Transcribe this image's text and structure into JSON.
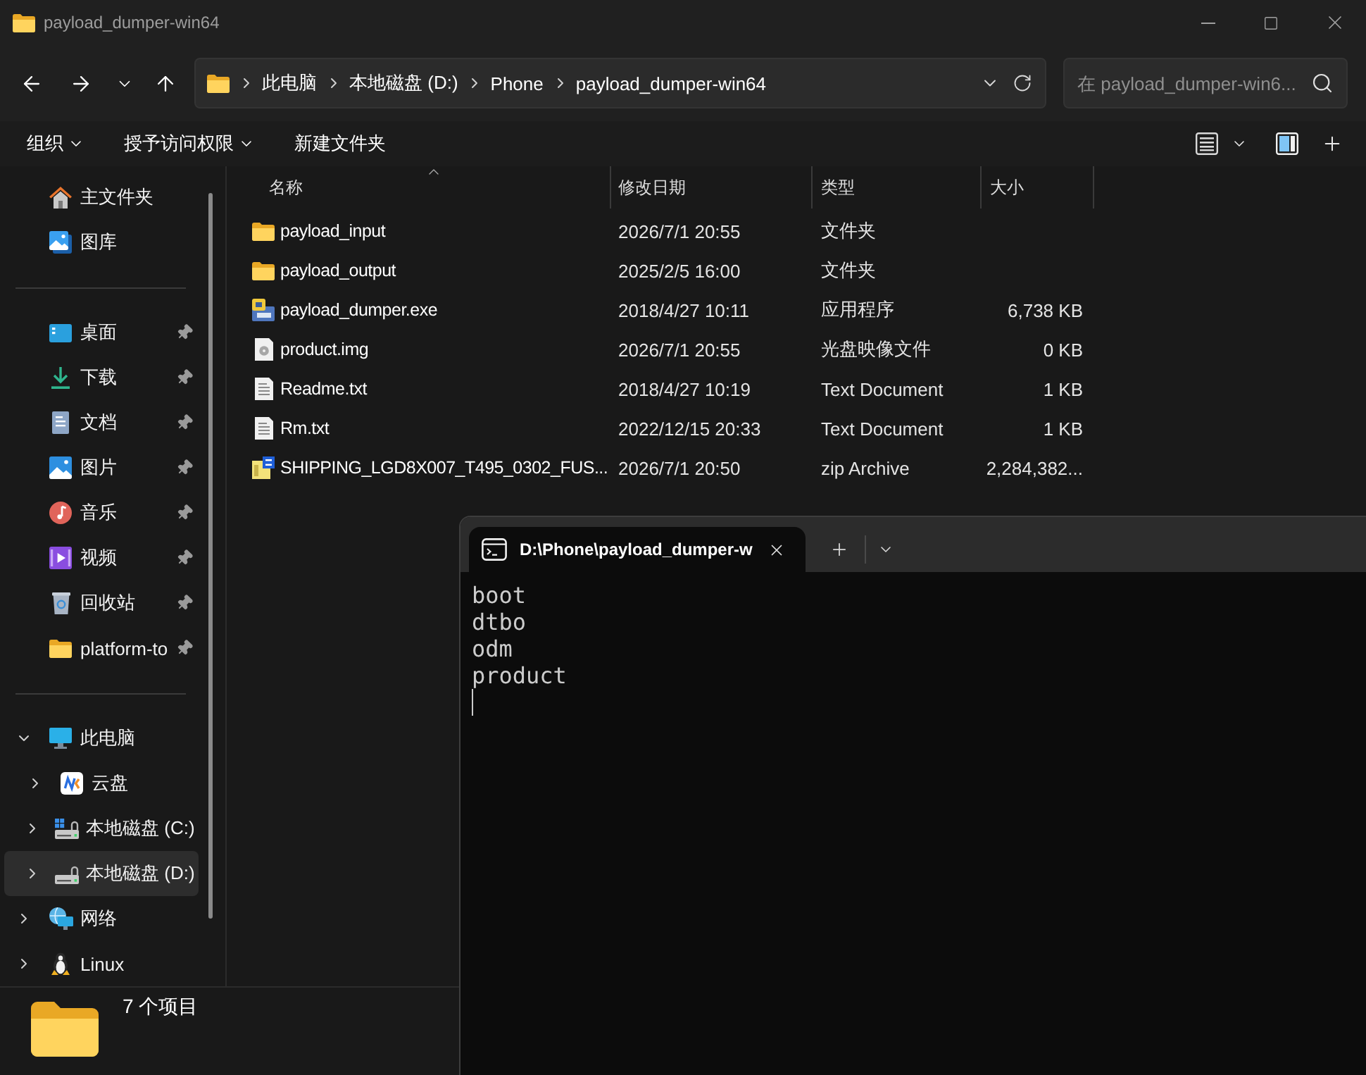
{
  "window": {
    "title": "payload_dumper-win64"
  },
  "address_bar": {
    "segments": [
      "此电脑",
      "本地磁盘 (D:)",
      "Phone",
      "payload_dumper-win64"
    ]
  },
  "search": {
    "placeholder": "在 payload_dumper-win6..."
  },
  "command_bar": {
    "items": [
      {
        "label": "组织",
        "has_menu": true
      },
      {
        "label": "授予访问权限",
        "has_menu": true
      },
      {
        "label": "新建文件夹",
        "has_menu": false
      }
    ]
  },
  "sidebar": {
    "top_items": [
      {
        "label": "主文件夹",
        "kind": "home",
        "selected": false
      },
      {
        "label": "图库",
        "kind": "gallery",
        "selected": false
      }
    ],
    "quick_access": [
      {
        "label": "桌面",
        "kind": "desktop",
        "pinned": true,
        "selected": false
      },
      {
        "label": "下载",
        "kind": "downloads",
        "pinned": true,
        "selected": false
      },
      {
        "label": "文档",
        "kind": "documents",
        "pinned": true,
        "selected": false
      },
      {
        "label": "图片",
        "kind": "pictures",
        "pinned": true,
        "selected": false
      },
      {
        "label": "音乐",
        "kind": "music",
        "pinned": true,
        "selected": false
      },
      {
        "label": "视频",
        "kind": "videos",
        "pinned": true,
        "selected": false
      },
      {
        "label": "回收站",
        "kind": "recycle_bin",
        "pinned": true,
        "selected": false
      },
      {
        "label": "platform-to",
        "kind": "folder",
        "pinned": true,
        "selected": false
      }
    ],
    "tree": [
      {
        "label": "此电脑",
        "kind": "pc",
        "expanded": true,
        "selected": false,
        "children": [
          {
            "label": "云盘",
            "kind": "cloud",
            "expanded": false,
            "selected": false
          },
          {
            "label": "本地磁盘 (C:)",
            "kind": "drive_system",
            "expanded": false,
            "selected": false
          },
          {
            "label": "本地磁盘 (D:)",
            "kind": "drive",
            "expanded": false,
            "selected": true
          }
        ]
      },
      {
        "label": "网络",
        "kind": "network",
        "expanded": false,
        "selected": false
      },
      {
        "label": "Linux",
        "kind": "linux",
        "expanded": false,
        "selected": false
      }
    ]
  },
  "file_list": {
    "columns": [
      {
        "label": "名称",
        "sorted": true
      },
      {
        "label": "修改日期",
        "sorted": false
      },
      {
        "label": "类型",
        "sorted": false
      },
      {
        "label": "大小",
        "sorted": false
      }
    ],
    "rows": [
      {
        "name": "payload_input",
        "modified": "2026/7/1 20:55",
        "type": "文件夹",
        "kind": "folder"
      },
      {
        "name": "payload_output",
        "modified": "2025/2/5 16:00",
        "type": "文件夹",
        "kind": "folder"
      },
      {
        "name": "payload_dumper.exe",
        "modified": "2018/4/27 10:11",
        "type": "应用程序",
        "size": "6,738 KB",
        "kind": "exe"
      },
      {
        "name": "product.img",
        "modified": "2026/7/1 20:55",
        "type": "光盘映像文件",
        "size": "0 KB",
        "kind": "disc_image"
      },
      {
        "name": "Readme.txt",
        "modified": "2018/4/27 10:19",
        "type": "Text Document",
        "size": "1 KB",
        "kind": "text"
      },
      {
        "name": "Rm.txt",
        "modified": "2022/12/15 20:33",
        "type": "Text Document",
        "size": "1 KB",
        "kind": "text"
      },
      {
        "name": "SHIPPING_LGD8X007_T495_0302_FUS...",
        "modified": "2026/7/1 20:50",
        "type": "zip Archive",
        "size": "2,284,382...",
        "kind": "zip"
      }
    ]
  },
  "status_bar": {
    "item_count": "7 个项目"
  },
  "terminal": {
    "tab_title": "D:\\Phone\\payload_dumper-w",
    "lines": [
      "boot",
      "dtbo",
      "odm",
      "product"
    ]
  }
}
